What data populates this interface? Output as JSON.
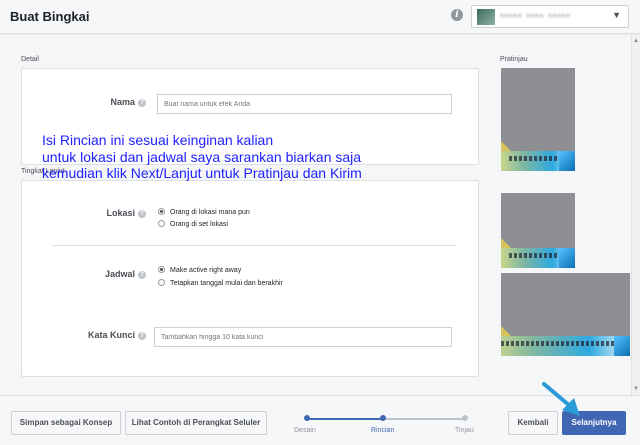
{
  "header": {
    "title": "Buat Bingkai",
    "account_name": "••••• •••• •••••"
  },
  "detail": {
    "section_label": "Detail",
    "name_label": "Nama",
    "name_placeholder": "Buat nama untuk efek Anda"
  },
  "annotation": {
    "line1": "Isi Rincian ini sesuai keinginan kalian",
    "line2": "untuk lokasi dan jadwal saya sarankan biarkan saja",
    "line3": "kemudian klik Next/Lanjut untuk Pratinjau dan Kirim"
  },
  "advanced": {
    "section_label": "Tingkat Lanjut",
    "location_label": "Lokasi",
    "location_options": [
      "Orang di lokasi mana pun",
      "Orang di set lokasi"
    ],
    "location_selected": 0,
    "schedule_label": "Jadwal",
    "schedule_options": [
      "Make active right away",
      "Tetapkan tanggal mulai dan berakhir"
    ],
    "schedule_selected": 0,
    "keyword_label": "Kata Kunci",
    "keyword_placeholder": "Tambahkan hingga 10 kata kunci"
  },
  "preview": {
    "label": "Pratinjau"
  },
  "footer": {
    "save_draft": "Simpan sebagai Konsep",
    "mobile_preview": "Lihat Contoh di Perangkat Seluler",
    "steps": [
      "Desain",
      "Rincian",
      "Tinjau"
    ],
    "current_step": 1,
    "back": "Kembali",
    "next": "Selanjutnya"
  },
  "colors": {
    "accent": "#4267b2",
    "step_active": "#4267b2",
    "step_inactive": "#bec3c9",
    "annotation": "#1e22ff",
    "arrow": "#2b9ad8"
  }
}
